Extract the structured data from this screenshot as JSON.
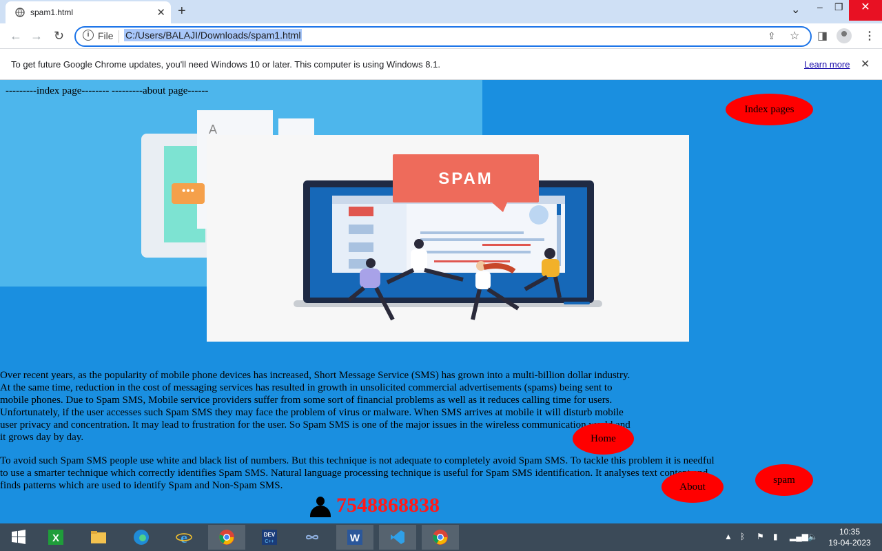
{
  "browser": {
    "tab_title": "spam1.html",
    "tab_close": "✕",
    "new_tab": "+",
    "file_label": "File",
    "url": "C:/Users/BALAJI/Downloads/spam1.html",
    "infobar_message": "To get future Google Chrome updates, you'll need Windows 10 or later. This computer is using Windows 8.1.",
    "infobar_link": "Learn more",
    "infobar_close": "✕",
    "minimize": "–",
    "restore": "❐",
    "close": "✕",
    "chevron": "⌄",
    "menu": "⋮"
  },
  "page": {
    "nav_text": "---------index page-------- ---------about page------",
    "spam_label": "SPAM",
    "buttons": {
      "index_pages": "Index pages",
      "home": "Home",
      "about": "About",
      "spam": "spam"
    },
    "paragraph1": "Over recent years, as the popularity of mobile phone devices has increased, Short Message Service (SMS) has grown into a multi-billion dollar industry. At the same time, reduction in the cost of messaging services has resulted in growth in unsolicited commercial advertisements (spams) being sent to mobile phones. Due to Spam SMS, Mobile service providers suffer from some sort of financial problems as well as it reduces calling time for users. Unfortunately, if the user accesses such Spam SMS they may face the problem of virus or malware. When SMS arrives at mobile it will disturb mobile user privacy and concentration. It may lead to frustration for the user. So Spam SMS is one of the major issues in the wireless communication world and it grows day by day.",
    "paragraph2": "To avoid such Spam SMS people use white and black list of numbers. But this technique is not adequate to completely avoid Spam SMS. To tackle this problem it is needful to use a smarter technique which correctly identifies Spam SMS. Natural language processing technique is useful for Spam SMS identification. It analyses text content and finds patterns which are used to identify Spam and Non-Spam SMS.",
    "phone": "7548868838"
  },
  "taskbar": {
    "time": "10:35",
    "date": "19-04-2023"
  },
  "colors": {
    "page_bg": "#1a8fe0",
    "button_red": "#ff0000",
    "phone_red": "#ff1a1a"
  }
}
